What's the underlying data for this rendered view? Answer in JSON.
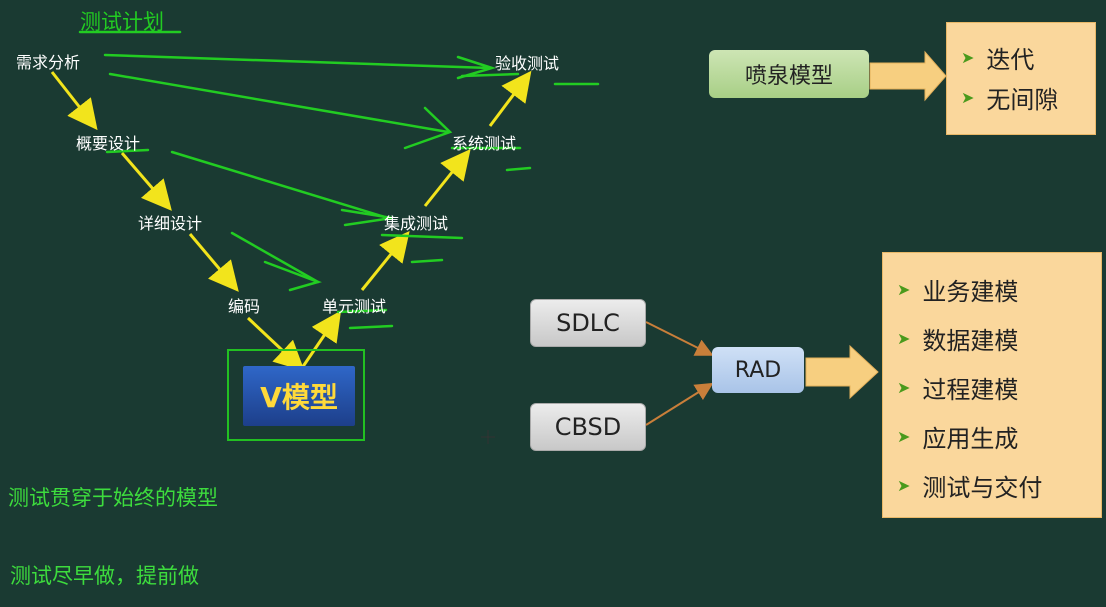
{
  "annotation_top": "测试计划",
  "v_model": {
    "left": [
      "需求分析",
      "概要设计",
      "详细设计",
      "编码"
    ],
    "right": [
      "单元测试",
      "集成测试",
      "系统测试",
      "验收测试"
    ],
    "button": "V模型"
  },
  "notes": [
    "测试贯穿于始终的模型",
    "测试尽早做，提前做"
  ],
  "fountain": {
    "label": "喷泉模型",
    "items": [
      "迭代",
      "无间隙"
    ]
  },
  "rad": {
    "inputs": [
      "SDLC",
      "CBSD"
    ],
    "label": "RAD",
    "items": [
      "业务建模",
      "数据建模",
      "过程建模",
      "应用生成",
      "测试与交付"
    ]
  },
  "colors": {
    "background": "#1a3a32",
    "yellow_arrow": "#f2e41c",
    "green_ink": "#22cc22",
    "panel": "#fad79c"
  },
  "icons": [
    "triangle-bullet-icon",
    "crosshair-cursor-icon"
  ]
}
